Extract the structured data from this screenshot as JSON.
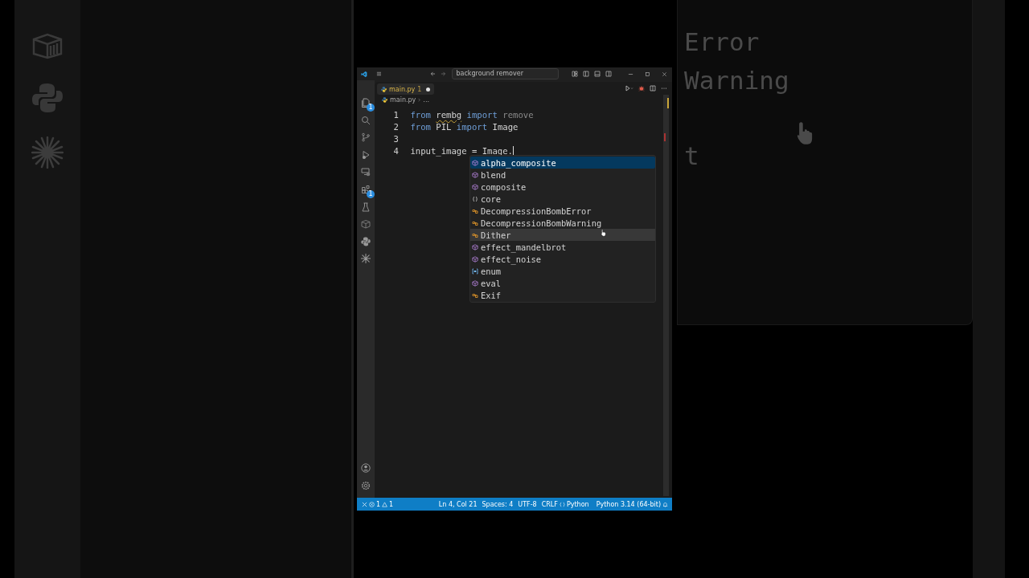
{
  "backdrop_right": {
    "texts": [
      "Error",
      "Warning",
      "t"
    ]
  },
  "title_bar": {
    "search": "background remover"
  },
  "activity_bar": {
    "explorer_badge": "1",
    "extensions_badge": "1"
  },
  "tab": {
    "label": "main.py",
    "problems": "1",
    "modified": true
  },
  "breadcrumb": [
    "main.py",
    "..."
  ],
  "code_lines": [
    {
      "number": "1",
      "tokens": [
        {
          "text": "from",
          "kind": "keyword"
        },
        {
          "text": "rembg",
          "kind": "warning"
        },
        {
          "text": "import",
          "kind": "keyword"
        },
        {
          "text": "remove",
          "kind": "unused"
        }
      ]
    },
    {
      "number": "2",
      "tokens": [
        {
          "text": "from",
          "kind": "keyword"
        },
        {
          "text": "PIL",
          "kind": "plain"
        },
        {
          "text": "import",
          "kind": "keyword"
        },
        {
          "text": "Image",
          "kind": "plain"
        }
      ]
    },
    {
      "number": "3"
    },
    {
      "number": "4",
      "tokens": [
        {
          "text": "input_image = Image.",
          "kind": "plain"
        }
      ],
      "cursor": true
    }
  ],
  "suggestions": [
    {
      "label": "alpha_composite",
      "kind": "function",
      "selected": true,
      "hovered": false
    },
    {
      "label": "blend",
      "kind": "function",
      "selected": false,
      "hovered": false
    },
    {
      "label": "composite",
      "kind": "function",
      "selected": false,
      "hovered": false
    },
    {
      "label": "core",
      "kind": "module",
      "selected": false,
      "hovered": false
    },
    {
      "label": "DecompressionBombError",
      "kind": "class",
      "selected": false,
      "hovered": false
    },
    {
      "label": "DecompressionBombWarning",
      "kind": "class",
      "selected": false,
      "hovered": false
    },
    {
      "label": "Dither",
      "kind": "class",
      "selected": false,
      "hovered": true
    },
    {
      "label": "effect_mandelbrot",
      "kind": "function",
      "selected": false,
      "hovered": false
    },
    {
      "label": "effect_noise",
      "kind": "function",
      "selected": false,
      "hovered": false
    },
    {
      "label": "enum",
      "kind": "variable",
      "selected": false,
      "hovered": false
    },
    {
      "label": "eval",
      "kind": "function",
      "selected": false,
      "hovered": false
    },
    {
      "label": "Exif",
      "kind": "class",
      "selected": false,
      "hovered": false
    }
  ],
  "status_bar": {
    "errors": "1",
    "warnings": "1",
    "items": [
      {
        "text": "Ln 4, Col 21",
        "kind": "text"
      },
      {
        "text": "Spaces: 4",
        "kind": "text"
      },
      {
        "text": "UTF-8",
        "kind": "text"
      },
      {
        "text": "CRLF",
        "kind": "text"
      },
      {
        "text": "Python",
        "kind": "language"
      },
      {
        "text": "Python 3.14 (64-bit)",
        "kind": "text"
      }
    ]
  }
}
